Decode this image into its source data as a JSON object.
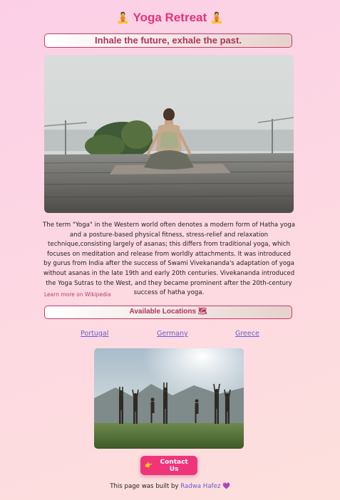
{
  "header": {
    "emoji_left": "🧘",
    "title": "Yoga Retreat",
    "emoji_right": "🧘"
  },
  "tagline": "Inhale the future, exhale the past.",
  "description": "The term \"Yoga\" in the Western world often denotes a modern form of Hatha yoga and a posture-based physical fitness, stress-relief and relaxation technique,consisting largely of asanas; this differs from traditional yoga, which focuses on meditation and release from worldly attachments. It was introduced by gurus from India after the success of Swami Vivekananda's adaptation of yoga without asanas in the late 19th and early 20th centuries. Vivekananda introduced the Yoga Sutras to the West, and they became prominent after the 20th-century success of hatha yoga.",
  "learn_more": "Learn more on Wikipedia",
  "locations": {
    "heading": "Available Locations",
    "heading_emoji": "🗺",
    "items": [
      "Portugal",
      "Germany",
      "Greece"
    ]
  },
  "contact": {
    "emoji": "👉",
    "label": "Contact Us"
  },
  "footer": {
    "prefix": "This page was built by",
    "author": "Radwa Hafez",
    "heart": "💜"
  },
  "colors": {
    "accent": "#e2327a",
    "button": "#f0347a",
    "link": "#6a5acd",
    "border": "#c93866"
  },
  "icons": {
    "title_icon": "person-in-lotus-position-icon",
    "map_icon": "world-map-icon",
    "pointing_icon": "backhand-index-pointing-right-icon",
    "heart_icon": "purple-heart-icon"
  }
}
